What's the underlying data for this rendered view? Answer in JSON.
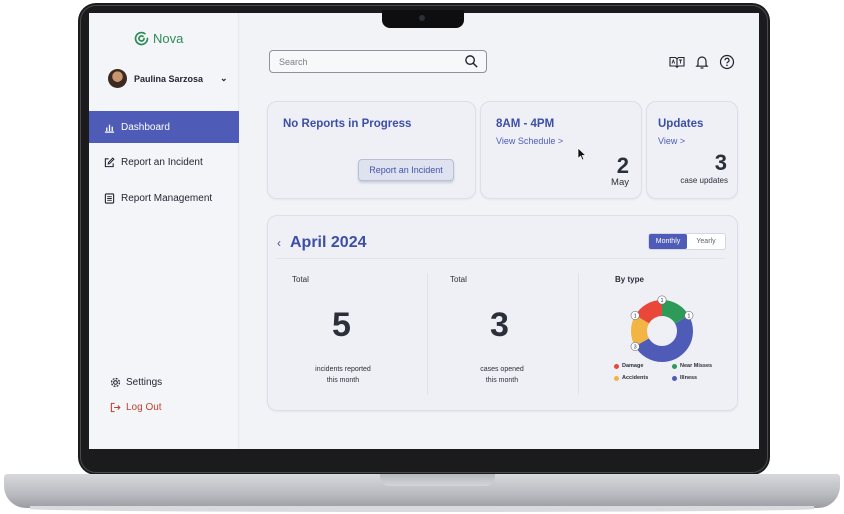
{
  "app": {
    "brand": "Nova",
    "brand_color": "#2e8b57",
    "accent": "#4e5cb8"
  },
  "user": {
    "name": "Paulina Sarzosa"
  },
  "sidebar": {
    "items": [
      {
        "label": "Dashboard",
        "icon": "bar-chart-icon",
        "active": true
      },
      {
        "label": "Report an Incident",
        "icon": "edit-icon",
        "active": false
      },
      {
        "label": "Report Management",
        "icon": "document-list-icon",
        "active": false
      }
    ],
    "settings_label": "Settings",
    "logout_label": "Log Out"
  },
  "search": {
    "placeholder": "Search"
  },
  "cards": {
    "reports": {
      "title": "No Reports in Progress",
      "button": "Report an Incident"
    },
    "schedule": {
      "title": "8AM - 4PM",
      "link": "View Schedule >",
      "day": "2",
      "month": "May"
    },
    "updates": {
      "title": "Updates",
      "link": "View >",
      "count": "3",
      "caption": "case updates"
    }
  },
  "calendar": {
    "title": "April 2024",
    "tabs": {
      "monthly": "Monthly",
      "yearly": "Yearly"
    },
    "stats": [
      {
        "label": "Total",
        "value": "5",
        "desc1": "incidents reported",
        "desc2": "this month"
      },
      {
        "label": "Total",
        "value": "3",
        "desc1": "cases opened",
        "desc2": "this month"
      }
    ],
    "by_type_title": "By type"
  },
  "chart_data": {
    "type": "pie",
    "title": "By type",
    "categories": [
      "Damage",
      "Near Misses",
      "Accidents",
      "Illness"
    ],
    "values": [
      1,
      1,
      1,
      3
    ],
    "colors": [
      "#e8473a",
      "#2e9a57",
      "#f2b443",
      "#4e5cb8"
    ]
  }
}
